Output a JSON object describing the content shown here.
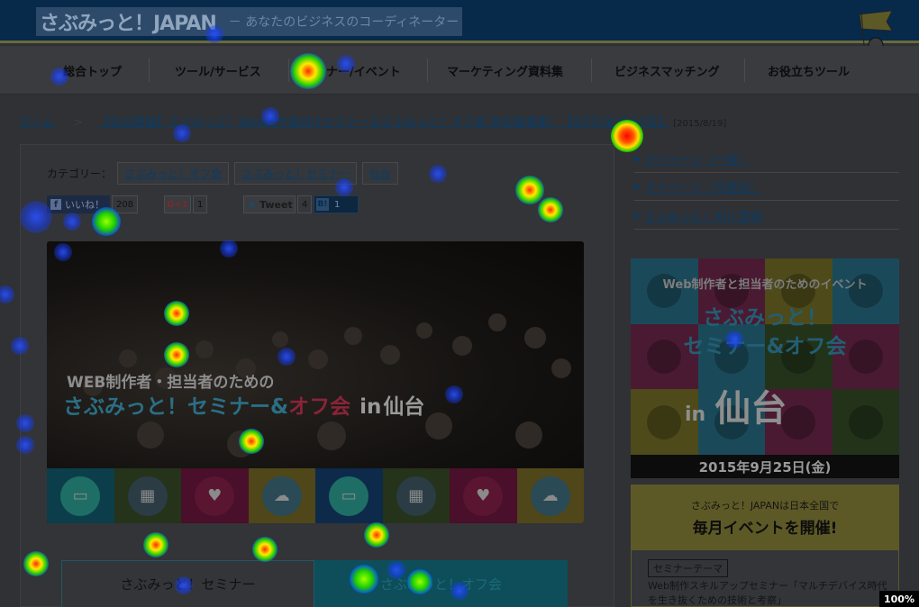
{
  "header": {
    "logo_main": "さぶみっと！JAPAN",
    "logo_sub": "－ あなたのビジネスのコーディネーター",
    "mascot_flag": "さぶみっと"
  },
  "nav": {
    "items": [
      {
        "label": "総合トップ"
      },
      {
        "label": "ツール/サービス"
      },
      {
        "label": "セミナー/イベント"
      },
      {
        "label": "マーケティング資料集"
      },
      {
        "label": "ビジネスマッチング"
      },
      {
        "label": "お役立ちツール"
      }
    ]
  },
  "breadcrumb": {
    "home": "ホーム",
    "separator": ">",
    "current": "【仙台開催】さぶみっと！Web制作者向けセミナー＆さぶみっと！オフ会 参加者募集！【9/25(金)各50名】",
    "date": "[2015/8/19]"
  },
  "category": {
    "label": "カテゴリー：",
    "tags": [
      "さぶみっと！オフ会",
      "さぶみっと！セミナー",
      "仙台"
    ]
  },
  "social": {
    "fb_label": "いいね！",
    "fb_count": "208",
    "gplus_label": "G+1",
    "gplus_count": "1",
    "tweet_label": "Tweet",
    "tweet_count": "4",
    "hatena_label": "B!",
    "hatena_count": "1"
  },
  "hero": {
    "line1": "WEB制作者・担当者のための",
    "line2_a": "さぶみっと！セミナー",
    "line2_amp": "&",
    "line2_off": "オフ会",
    "line2_in": "in",
    "line2_city": "仙台",
    "icons": [
      {
        "name": "monitor-icon",
        "glyph": "▭",
        "bg": "#0b3e4a",
        "circle": "#1f6e66"
      },
      {
        "name": "tablet-icon",
        "glyph": "▦",
        "bg": "#24331a",
        "circle": "#2b3c45"
      },
      {
        "name": "heart-icon",
        "glyph": "♥",
        "bg": "#4a0f2a",
        "circle": "#5a1531"
      },
      {
        "name": "chat-icon",
        "glyph": "☁",
        "bg": "#4f4719",
        "circle": "#2a4a55"
      },
      {
        "name": "monitor-icon",
        "glyph": "▭",
        "bg": "#0d2a4a",
        "circle": "#1f6e66"
      },
      {
        "name": "tablet-icon",
        "glyph": "▦",
        "bg": "#24331a",
        "circle": "#2b3c45"
      },
      {
        "name": "heart-icon",
        "glyph": "♥",
        "bg": "#4a0f2a",
        "circle": "#5a1531"
      },
      {
        "name": "chat-icon",
        "glyph": "☁",
        "bg": "#4f4719",
        "circle": "#2a4a55"
      }
    ]
  },
  "tabs": [
    {
      "label": "さぶみっと！セミナー",
      "active": true
    },
    {
      "label": "さぶみっと！オフ会",
      "active": false
    }
  ],
  "sidebar": {
    "links": [
      {
        "label": "マイページ（一般）"
      },
      {
        "label": "マイページ（代理店）"
      },
      {
        "label": "さぶみっと！IDに登録"
      }
    ],
    "banner": {
      "title": "Web制作者と担当者のためのイベント",
      "main_1": "さぶみっと！",
      "main_2": "セミナー&オフ会",
      "in": "in",
      "city": "仙台",
      "date": "2015年9月25日(金)"
    },
    "event": {
      "head_1": "さぶみっと！JAPANは日本全国で",
      "head_2": "毎月イベントを開催!",
      "theme_tag": "セミナーテーマ",
      "theme_text": "Web制作スキルアップセミナー「マルチデバイス時代を生き抜くための技術と考察」"
    }
  },
  "zoom": "100%",
  "colors": {
    "header_bg": "#07294a",
    "link": "#0b3c66",
    "overlay_bg": "#2f3134"
  }
}
